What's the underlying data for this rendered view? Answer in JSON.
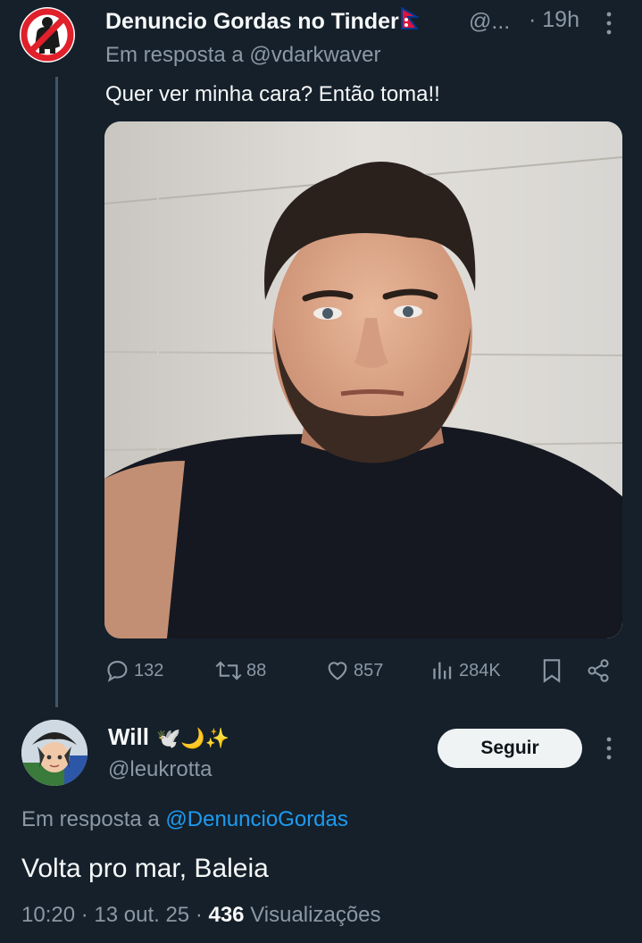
{
  "tweet1": {
    "display_name": "Denuncio Gordas no Tinder",
    "handle": "@...",
    "time": "· 19h",
    "reply_prefix": "Em resposta a",
    "reply_to": "@vdarkwaver",
    "text": "Quer ver minha cara? Então toma!!",
    "avatar_icon": "prohibition-icon",
    "flag_icon": "nepal-flag-icon",
    "actions": {
      "replies": "132",
      "retweets": "88",
      "likes": "857",
      "views": "284K"
    }
  },
  "tweet2": {
    "display_name": "Will",
    "emojis": "🕊️🌙✨",
    "handle": "@leukrotta",
    "follow_label": "Seguir",
    "reply_prefix": "Em resposta a",
    "reply_to": "@DenuncioGordas",
    "text": "Volta pro mar, Baleia",
    "time": "10:20",
    "date": "13 out. 25",
    "views_count": "436",
    "views_label": "Visualizações"
  },
  "colors": {
    "background": "#15202b",
    "primary_text": "#f7f9f9",
    "secondary_text": "#8b98a5",
    "link": "#1d9bf0",
    "thread_line": "#425566",
    "prohibition_red": "#e0202a"
  }
}
